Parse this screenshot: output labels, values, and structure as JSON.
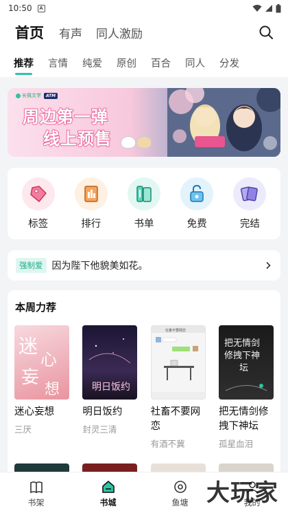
{
  "status_bar": {
    "time": "10:50",
    "badge": "A"
  },
  "header": {
    "main_tab": "首页",
    "tabs": [
      "有声",
      "同人激励"
    ]
  },
  "sub_tabs": [
    "推荐",
    "言情",
    "纯爱",
    "原创",
    "百合",
    "同人",
    "分发"
  ],
  "banner": {
    "line1": "周边第一弹",
    "line2": "线上预售",
    "logo_text": "长佩文学"
  },
  "categories": [
    {
      "label": "标签",
      "icon": "tag-icon",
      "color": "#e8567a",
      "bg": "#fde8ee"
    },
    {
      "label": "排行",
      "icon": "ranking-icon",
      "color": "#f08a3c",
      "bg": "#fff0e2"
    },
    {
      "label": "书单",
      "icon": "booklist-icon",
      "color": "#2ec4a4",
      "bg": "#e2f7f2"
    },
    {
      "label": "免费",
      "icon": "free-lock-icon",
      "color": "#3fa8e0",
      "bg": "#e3f3fc"
    },
    {
      "label": "完结",
      "icon": "finished-cards-icon",
      "color": "#7b6fd6",
      "bg": "#ecebfb"
    }
  ],
  "notice": {
    "tag": "强制爱",
    "text": "因为陛下他貌美如花。"
  },
  "weekly": {
    "title": "本周力荐",
    "books": [
      {
        "title": "迷心妄想",
        "author": "三厌",
        "cover_text": "迷心妄想"
      },
      {
        "title": "明日饭约",
        "author": "封灵三清",
        "cover_text": "明日饭约"
      },
      {
        "title": "社畜不要网恋",
        "author": "有酒不冀",
        "cover_text": "社畜不要网恋"
      },
      {
        "title": "把无情剑修拽下神坛",
        "author": "孤星血泪",
        "cover_text": "把无情剑修拽下神坛"
      }
    ]
  },
  "bottom_nav": [
    {
      "label": "书架",
      "icon": "bookshelf-icon"
    },
    {
      "label": "书城",
      "icon": "bookstore-icon",
      "active": true
    },
    {
      "label": "鱼塘",
      "icon": "fishpond-icon"
    },
    {
      "label": "我的",
      "icon": "profile-icon"
    }
  ],
  "watermark": "大玩家"
}
